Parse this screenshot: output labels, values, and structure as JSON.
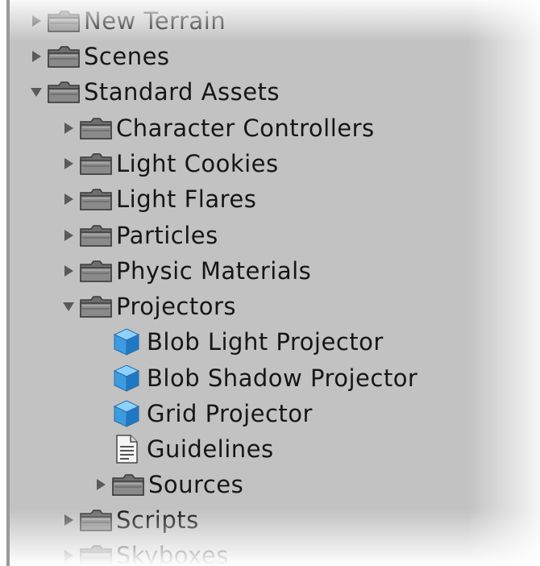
{
  "project_tree": {
    "items": [
      {
        "label": "New Terrain",
        "icon": "folder-icon",
        "expanded": false,
        "depth": 0
      },
      {
        "label": "Scenes",
        "icon": "folder-icon",
        "expanded": false,
        "depth": 0
      },
      {
        "label": "Standard Assets",
        "icon": "folder-icon",
        "expanded": true,
        "depth": 0
      },
      {
        "label": "Character Controllers",
        "icon": "folder-icon",
        "expanded": false,
        "depth": 1
      },
      {
        "label": "Light Cookies",
        "icon": "folder-icon",
        "expanded": false,
        "depth": 1
      },
      {
        "label": "Light Flares",
        "icon": "folder-icon",
        "expanded": false,
        "depth": 1
      },
      {
        "label": "Particles",
        "icon": "folder-icon",
        "expanded": false,
        "depth": 1
      },
      {
        "label": "Physic Materials",
        "icon": "folder-icon",
        "expanded": false,
        "depth": 1
      },
      {
        "label": "Projectors",
        "icon": "folder-icon",
        "expanded": true,
        "depth": 1
      },
      {
        "label": "Blob Light Projector",
        "icon": "prefab-cube-icon",
        "depth": 2
      },
      {
        "label": "Blob Shadow Projector",
        "icon": "prefab-cube-icon",
        "depth": 2
      },
      {
        "label": "Grid Projector",
        "icon": "prefab-cube-icon",
        "depth": 2
      },
      {
        "label": "Guidelines",
        "icon": "text-document-icon",
        "depth": 2
      },
      {
        "label": "Sources",
        "icon": "folder-icon",
        "expanded": false,
        "depth": 2
      },
      {
        "label": "Scripts",
        "icon": "folder-icon",
        "expanded": false,
        "depth": 1
      },
      {
        "label": "Skyboxes",
        "icon": "folder-icon",
        "expanded": false,
        "depth": 1
      }
    ]
  },
  "colors": {
    "panel_bg": "#c2c2c2",
    "text": "#161616",
    "arrow": "#5a5a5a",
    "cube": "#3d9be0"
  }
}
